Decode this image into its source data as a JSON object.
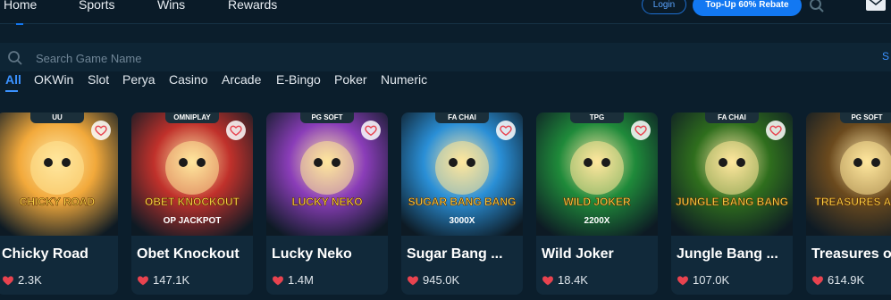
{
  "nav": {
    "items": [
      "Home",
      "Sports",
      "Wins",
      "Rewards"
    ],
    "login_label": "Login",
    "topup_label": "Top-Up 60% Rebate"
  },
  "search": {
    "placeholder": "Search Game Name",
    "cut_text": "S"
  },
  "tabs": [
    "All",
    "OKWin",
    "Slot",
    "Perya",
    "Casino",
    "Arcade",
    "E-Bingo",
    "Poker",
    "Numeric"
  ],
  "active_tab": "All",
  "games": [
    {
      "title": "Chicky Road",
      "provider": "UU",
      "likes": "2.3K",
      "art": "CHICKY ROAD",
      "color": "#f2a93b"
    },
    {
      "title": "Obet Knockout",
      "provider": "OMNIPLAY",
      "likes": "147.1K",
      "art": "OBET KNOCKOUT",
      "art2": "OP JACKPOT",
      "color": "#c0312b"
    },
    {
      "title": "Lucky Neko",
      "provider": "PG SOFT",
      "likes": "1.4M",
      "art": "LUCKY NEKO",
      "color": "#8a3db8"
    },
    {
      "title": "Sugar Bang ...",
      "provider": "FA CHAI",
      "likes": "945.0K",
      "art": "SUGAR BANG BANG",
      "art2": "3000X",
      "color": "#2a8fd6"
    },
    {
      "title": "Wild Joker",
      "provider": "TPG",
      "likes": "18.4K",
      "art": "WILD JOKER",
      "art2": "2200X",
      "color": "#1f8a3a"
    },
    {
      "title": "Jungle Bang ...",
      "provider": "FA CHAI",
      "likes": "107.0K",
      "art": "JUNGLE BANG BANG",
      "color": "#2f6e1d"
    },
    {
      "title": "Treasures o",
      "provider": "PG SOFT",
      "likes": "614.9K",
      "art": "TREASURES AZTEC",
      "color": "#6b4a1e"
    }
  ],
  "colors": {
    "background": "#0b1e2c",
    "card": "#11293a",
    "accent": "#1278f2",
    "heart": "#e8434f"
  }
}
